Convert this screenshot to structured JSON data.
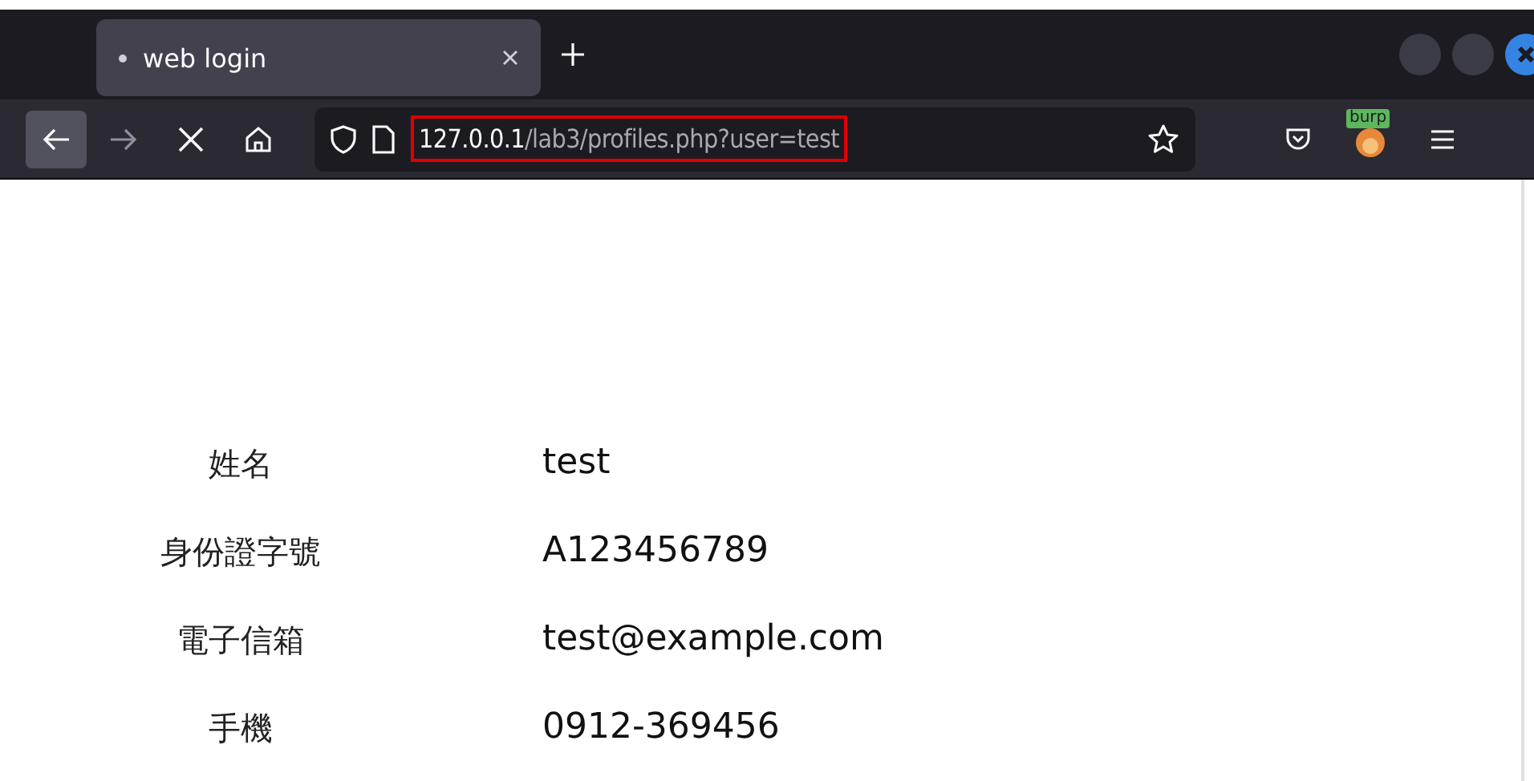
{
  "tabs": [
    {
      "title": "web login",
      "selected": true
    }
  ],
  "address_bar": {
    "host": "127.0.0.1",
    "path": "/lab3/profiles.php?user=test",
    "highlighted": true
  },
  "extension_badge": "burp",
  "profile": [
    {
      "label": "姓名",
      "value": "test"
    },
    {
      "label": "身份證字號",
      "value": "A123456789"
    },
    {
      "label": "電子信箱",
      "value": "test@example.com"
    },
    {
      "label": "手機",
      "value": "0912-369456"
    }
  ]
}
